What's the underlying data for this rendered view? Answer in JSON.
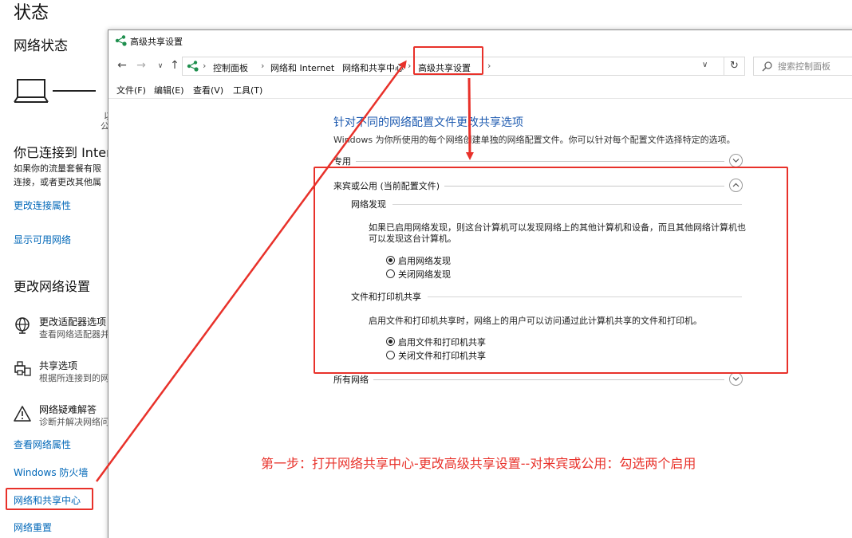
{
  "background": {
    "title": "状态",
    "network_status": "网络状态",
    "peek_lines": [
      "以",
      "公"
    ],
    "connected_title": "你已连接到 Inter",
    "connected_desc": [
      "如果你的流量套餐有限",
      "连接，或者更改其他属"
    ],
    "links": {
      "change_connection": "更改连接属性",
      "show_available": "显示可用网络",
      "view_properties": "查看网络属性",
      "firewall": "Windows 防火墙",
      "sharing_center": "网络和共享中心",
      "reset": "网络重置"
    },
    "change_settings_title": "更改网络设置",
    "options": [
      {
        "title": "更改适配器选项",
        "sub": "查看网络适配器并",
        "icon": "adapter-globe-icon"
      },
      {
        "title": "共享选项",
        "sub": "根据所连接到的网",
        "icon": "sharing-printer-icon"
      },
      {
        "title": "网络疑难解答",
        "sub": "诊断并解决网络问",
        "icon": "warning-icon"
      }
    ]
  },
  "window": {
    "title": "高级共享设置",
    "breadcrumbs": [
      "控制面板",
      "网络和 Internet",
      "网络和共享中心",
      "高级共享设置"
    ],
    "search_placeholder": "搜索控制面板",
    "menu": [
      "文件(F)",
      "编辑(E)",
      "查看(V)",
      "工具(T)"
    ],
    "heading": "针对不同的网络配置文件更改共享选项",
    "intro": "Windows 为你所使用的每个网络创建单独的网络配置文件。你可以针对每个配置文件选择特定的选项。",
    "sections": {
      "private": "专用",
      "guest": "来宾或公用 (当前配置文件)",
      "all": "所有网络"
    },
    "discovery": {
      "label": "网络发现",
      "desc": [
        "如果已启用网络发现，则这台计算机可以发现网络上的其他计算机和设备，而且其他网络计算机也",
        "可以发现这台计算机。"
      ],
      "on_label": "启用网络发现",
      "off_label": "关闭网络发现",
      "selected": "on"
    },
    "file_sharing": {
      "label": "文件和打印机共享",
      "desc": "启用文件和打印机共享时，网络上的用户可以访问通过此计算机共享的文件和打印机。",
      "on_label": "启用文件和打印机共享",
      "off_label": "关闭文件和打印机共享",
      "selected": "on"
    }
  },
  "annotation": {
    "note": "第一步：打开网络共享中心-更改高级共享设置--对来宾或公用：勾选两个启用",
    "color": "#e8312a"
  },
  "colors": {
    "link": "#0067b8",
    "heading": "#1e5bb0",
    "annotation": "#e8312a"
  }
}
